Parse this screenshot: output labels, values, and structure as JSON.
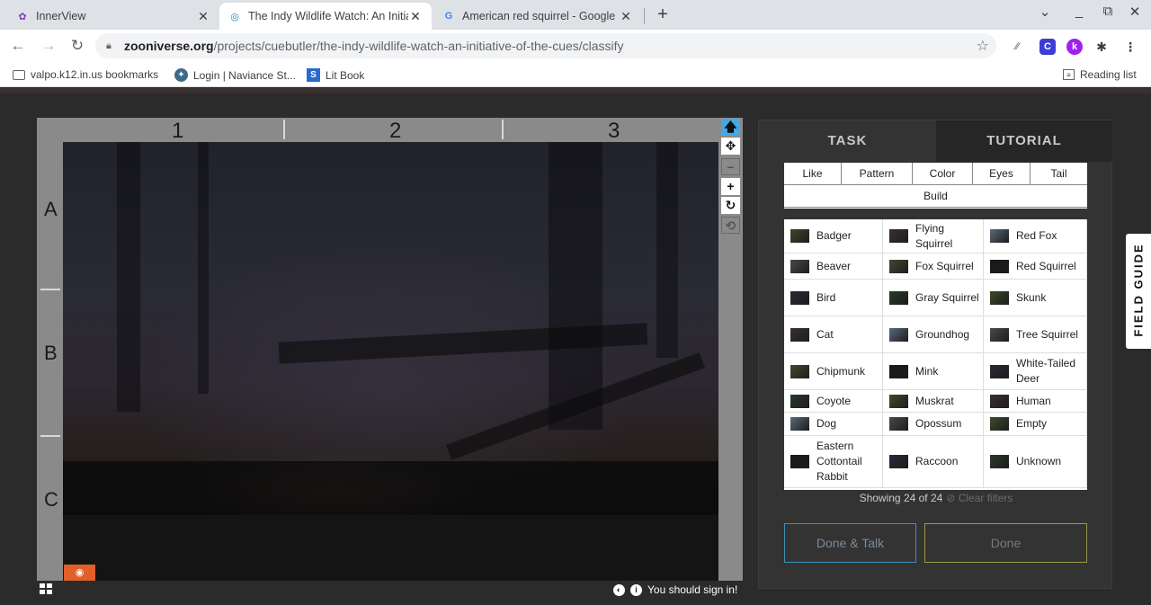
{
  "browser": {
    "tabs": [
      {
        "title": "InnerView",
        "icon": "innerview-icon"
      },
      {
        "title": "The Indy Wildlife Watch: An Initia",
        "icon": "zooniverse-icon"
      },
      {
        "title": "American red squirrel - Google Se",
        "icon": "google-icon"
      }
    ],
    "new_tab": "+",
    "url_host": "zooniverse.org",
    "url_path": "/projects/cuebutler/the-indy-wildlife-watch-an-initiative-of-the-cues/classify",
    "bookmarks": [
      "valpo.k12.in.us bookmarks",
      "Login | Naviance St...",
      "Lit Book"
    ],
    "reading_list": "Reading list"
  },
  "subject": {
    "columns": [
      "1",
      "2",
      "3"
    ],
    "rows": [
      "A",
      "B",
      "C"
    ]
  },
  "tools": {
    "pointer": "🡅",
    "move": "✥",
    "zoom_out": "−",
    "zoom_in": "+",
    "rotate": "↻",
    "reset": "⟲"
  },
  "footer": {
    "sign_in": "You should sign in!"
  },
  "panel": {
    "task_tab": "TASK",
    "tutorial_tab": "TUTORIAL",
    "filters": [
      "Like",
      "Pattern",
      "Color",
      "Eyes",
      "Tail",
      "Build"
    ],
    "species": [
      "Badger",
      "Flying Squirrel",
      "Red Fox",
      "Beaver",
      "Fox Squirrel",
      "Red Squirrel",
      "Bird",
      "Gray Squirrel",
      "Skunk",
      "Cat",
      "Groundhog",
      "Tree Squirrel",
      "Chipmunk",
      "Mink",
      "White-Tailed Deer",
      "Coyote",
      "Muskrat",
      "Human",
      "Dog",
      "Opossum",
      "Empty",
      "Eastern Cottontail Rabbit",
      "Raccoon",
      "Unknown"
    ],
    "showing": "Showing 24 of 24",
    "clear_filters": "⊘ Clear filters",
    "done_talk": "Done & Talk",
    "done": "Done"
  },
  "field_guide": "FIELD GUIDE",
  "colors": {
    "accent_blue": "#44a8e6",
    "eye_button": "#e0602a",
    "panel_bg": "#333333"
  }
}
